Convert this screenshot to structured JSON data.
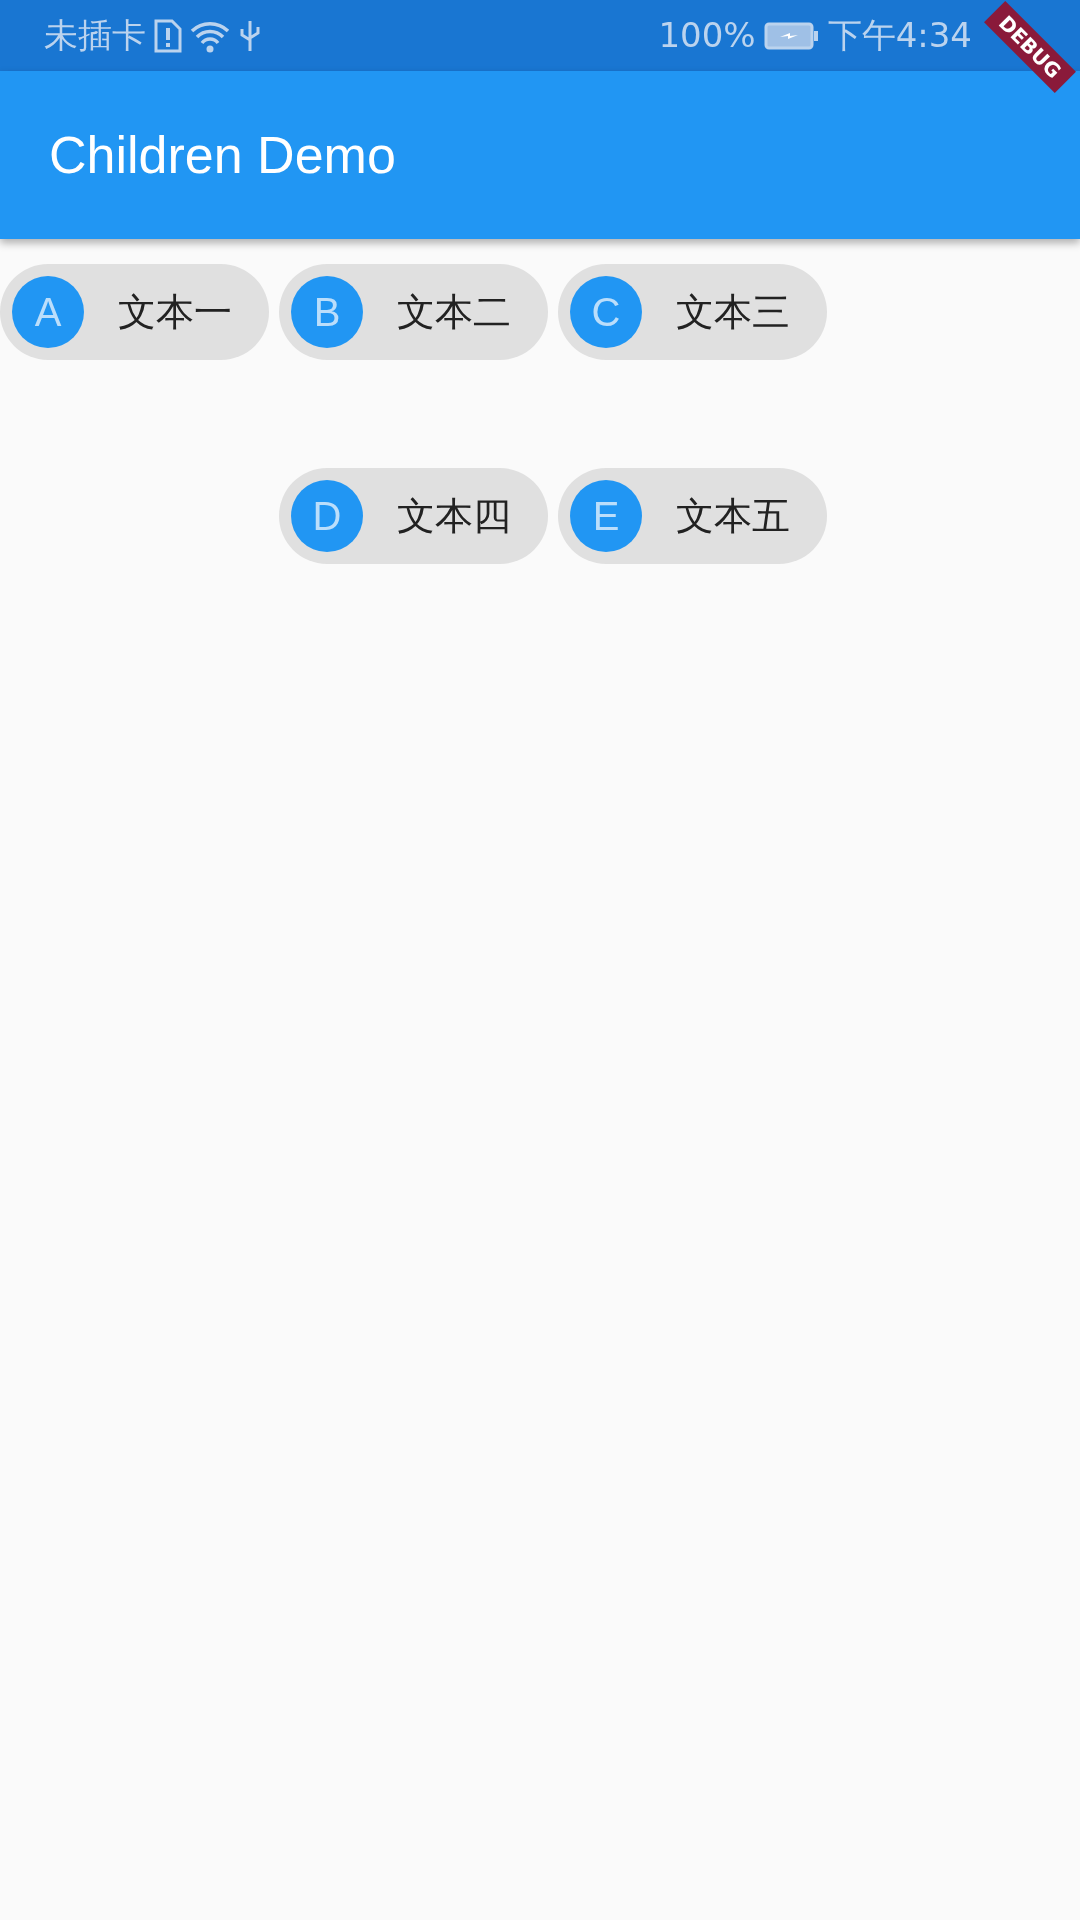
{
  "status_bar": {
    "carrier": "未插卡",
    "battery": "100%",
    "time": "下午4:34"
  },
  "debug_banner": "DEBUG",
  "app_bar": {
    "title": "Children Demo"
  },
  "chip_rows": [
    [
      {
        "avatar": "A",
        "label": "文本一"
      },
      {
        "avatar": "B",
        "label": "文本二"
      },
      {
        "avatar": "C",
        "label": "文本三"
      }
    ],
    [
      {
        "avatar": "D",
        "label": "文本四"
      },
      {
        "avatar": "E",
        "label": "文本五"
      }
    ]
  ]
}
